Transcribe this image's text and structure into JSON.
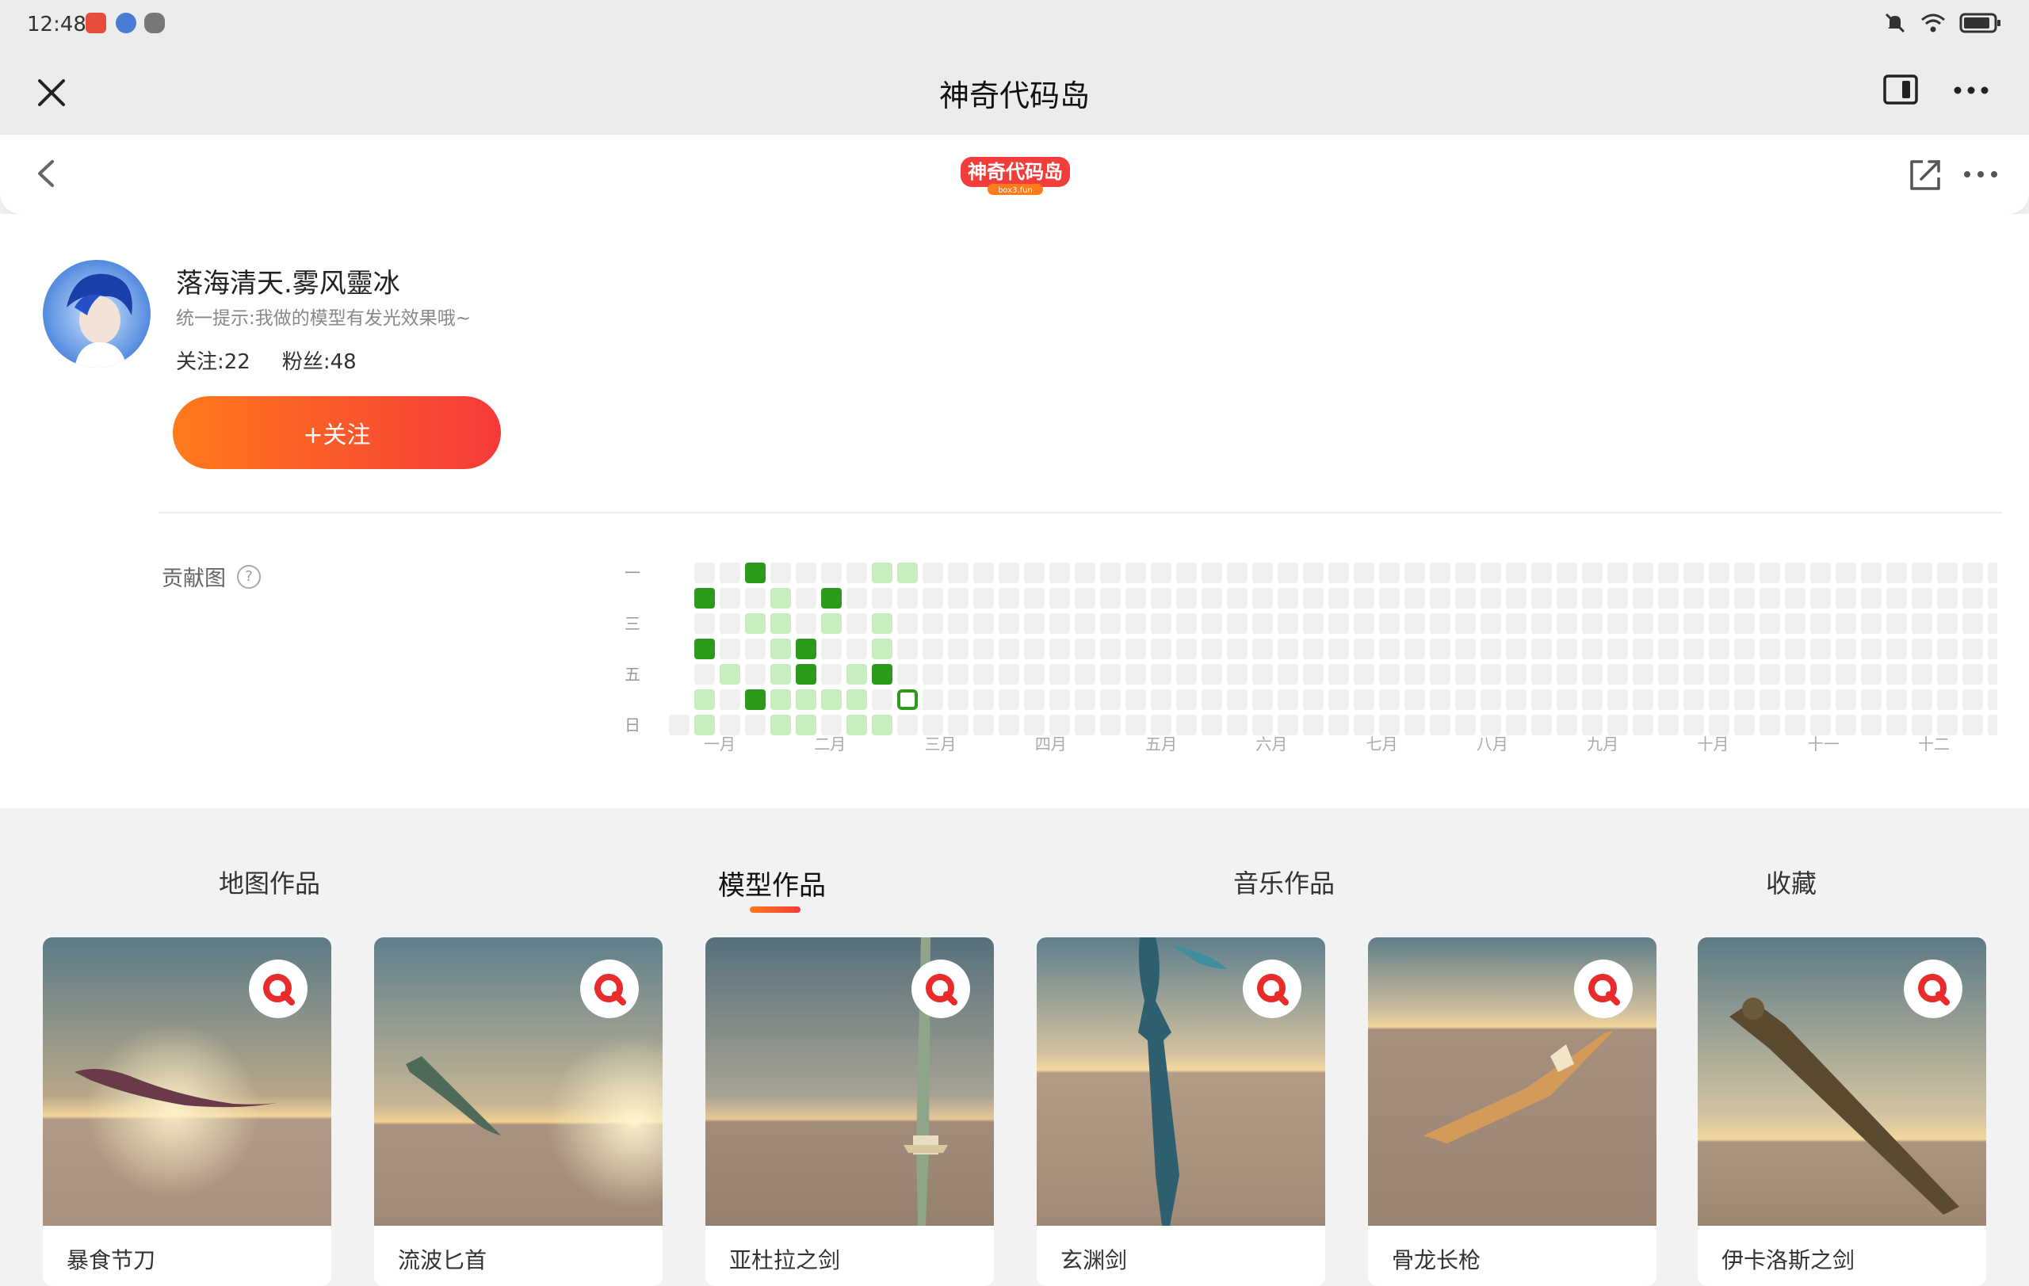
{
  "status": {
    "time": "12:48"
  },
  "app": {
    "title": "神奇代码岛"
  },
  "logo": {
    "text": "神奇代码岛",
    "sub": "box3.fun"
  },
  "profile": {
    "name": "落海清天.雾风靈冰",
    "bio": "统一提示:我做的模型有发光效果哦~",
    "following_label": "关注:22",
    "followers_label": "粉丝:48",
    "follow_button": "+关注"
  },
  "contrib": {
    "label": "贡献图",
    "weekday_labels": [
      "一",
      "三",
      "五",
      "日"
    ],
    "month_labels": [
      "一月",
      "二月",
      "三月",
      "四月",
      "五月",
      "六月",
      "七月",
      "八月",
      "九月",
      "十月",
      "十一",
      "十二"
    ]
  },
  "tabs": [
    {
      "label": "地图作品"
    },
    {
      "label": "模型作品",
      "active": true
    },
    {
      "label": "音乐作品"
    },
    {
      "label": "收藏"
    }
  ],
  "cards": [
    {
      "title": "暴食节刀"
    },
    {
      "title": "流波匕首"
    },
    {
      "title": "亚杜拉之剑"
    },
    {
      "title": "玄渊剑"
    },
    {
      "title": "骨龙长枪"
    },
    {
      "title": "伊卡洛斯之剑"
    }
  ],
  "colors": {
    "accent_start": "#ff7a1a",
    "accent_end": "#f53a3a",
    "contrib_dark": "#2e9a1c",
    "contrib_light": "#c9ecc0",
    "contrib_empty": "#efefef"
  }
}
